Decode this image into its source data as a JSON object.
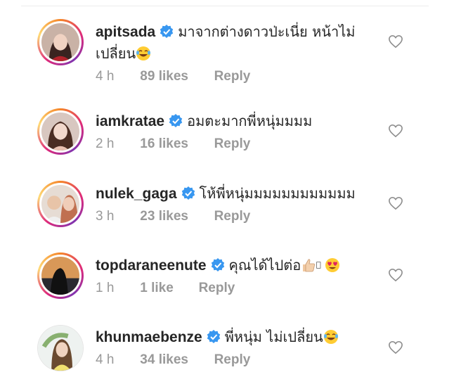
{
  "comments": [
    {
      "username": "apitsada",
      "text": "มาจากต่างดาวป่ะเนี่ย หน้าไม่",
      "text2": "เปลี่ยน",
      "time": "4 h",
      "likes": "89 likes",
      "reply": "Reply",
      "emoji": "joy-emoji"
    },
    {
      "username": "iamkratae",
      "text": "อมตะมากพี่หนุ่มมมม",
      "time": "2 h",
      "likes": "16 likes",
      "reply": "Reply"
    },
    {
      "username": "nulek_gaga",
      "text": "โห้พี่หนุ่มมมมมมมมมมมม",
      "time": "3 h",
      "likes": "23 likes",
      "reply": "Reply"
    },
    {
      "username": "topdaraneenute",
      "text": "คุณได้ไปต่อ",
      "time": "1 h",
      "likes": "1 like",
      "reply": "Reply"
    },
    {
      "username": "khunmaebenze",
      "text": "พี่หนุ่ม ไม่เปลี่ยน",
      "time": "4 h",
      "likes": "34 likes",
      "reply": "Reply"
    }
  ],
  "colors": {
    "verified": "#3897f0",
    "meta": "#999999",
    "text": "#262626"
  }
}
